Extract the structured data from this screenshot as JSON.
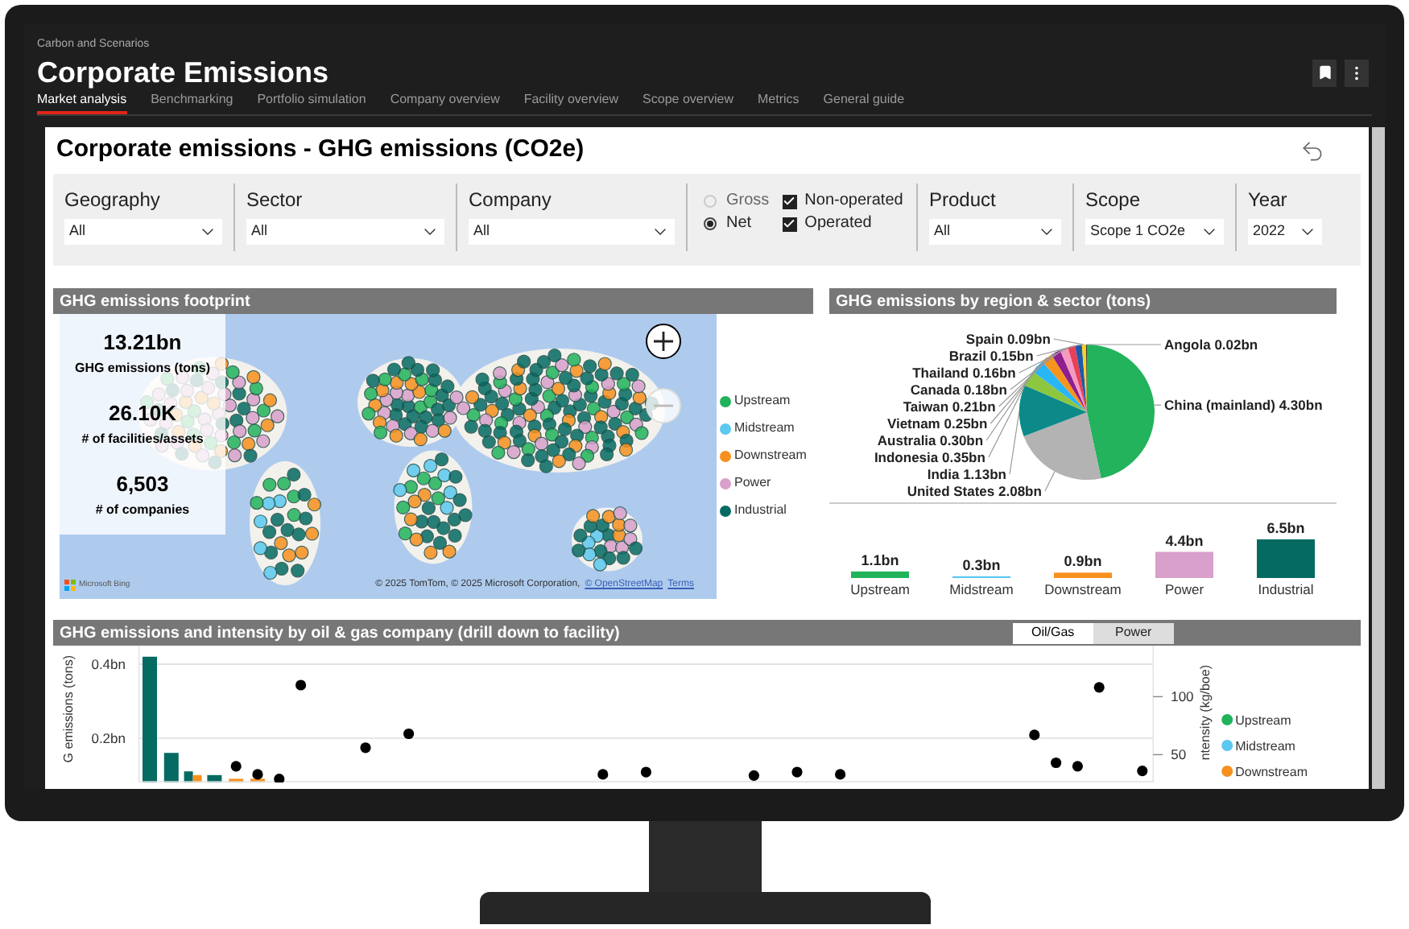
{
  "app": {
    "breadcrumb": "Carbon and Scenarios",
    "title": "Corporate Emissions"
  },
  "tabs": [
    {
      "label": "Market analysis",
      "selected": true
    },
    {
      "label": "Benchmarking",
      "selected": false
    },
    {
      "label": "Portfolio simulation",
      "selected": false
    },
    {
      "label": "Company overview",
      "selected": false
    },
    {
      "label": "Facility overview",
      "selected": false
    },
    {
      "label": "Scope overview",
      "selected": false
    },
    {
      "label": "Metrics",
      "selected": false
    },
    {
      "label": "General guide",
      "selected": false
    }
  ],
  "report": {
    "title": "Corporate emissions - GHG emissions (CO2e)"
  },
  "filters": [
    {
      "kind": "dropdown",
      "label": "Geography",
      "value": "All"
    },
    {
      "kind": "dropdown",
      "label": "Sector",
      "value": "All"
    },
    {
      "kind": "dropdown",
      "label": "Company",
      "value": "All"
    },
    {
      "kind": "options",
      "radios": [
        {
          "label": "Gross",
          "selected": false
        },
        {
          "label": "Net",
          "selected": true
        }
      ],
      "checkboxes": [
        {
          "label": "Non-operated",
          "checked": true
        },
        {
          "label": "Operated",
          "checked": true
        }
      ]
    },
    {
      "kind": "dropdown",
      "label": "Product",
      "value": "All"
    },
    {
      "kind": "dropdown",
      "label": "Scope",
      "value": "Scope 1 CO2e"
    },
    {
      "kind": "dropdown",
      "label": "Year",
      "value": "2022"
    }
  ],
  "footprint": {
    "title": "GHG emissions footprint",
    "kpis": [
      {
        "value": "13.21bn",
        "label": "GHG emissions (tons)"
      },
      {
        "value": "26.10K",
        "label": "# of facilities/assets"
      },
      {
        "value": "6,503",
        "label": "# of companies"
      }
    ],
    "legend": [
      {
        "label": "Upstream",
        "color": "#21b35b"
      },
      {
        "label": "Midstream",
        "color": "#5bc8f0"
      },
      {
        "label": "Downstream",
        "color": "#f7901e"
      },
      {
        "label": "Power",
        "color": "#d9a0cc"
      },
      {
        "label": "Industrial",
        "color": "#046a62"
      }
    ],
    "provider": "Microsoft Bing",
    "attribution": "© 2025 TomTom, © 2025 Microsoft Corporation,",
    "links": [
      "© OpenStreetMap",
      "Terms"
    ]
  },
  "region_sector": {
    "title": "GHG emissions by region & sector (tons)",
    "chart_data": {
      "type": "pie",
      "categories": [
        "China (mainland)",
        "United States",
        "India",
        "Indonesia",
        "Australia",
        "Vietnam",
        "Taiwan",
        "Canada",
        "Thailand",
        "Brazil",
        "Spain",
        "Angola"
      ],
      "values": [
        4.3,
        2.08,
        1.13,
        0.35,
        0.3,
        0.25,
        0.21,
        0.18,
        0.16,
        0.15,
        0.09,
        0.02
      ],
      "value_labels": [
        "4.30bn",
        "2.08bn",
        "1.13bn",
        "0.35bn",
        "0.30bn",
        "0.25bn",
        "0.21bn",
        "0.18bn",
        "0.16bn",
        "0.15bn",
        "0.09bn",
        "0.02bn"
      ],
      "colors": [
        "#22b35c",
        "#b3b3b3",
        "#0c8a8a",
        "#8dc63f",
        "#29b6f6",
        "#f7941d",
        "#8e1f8e",
        "#f49ac1",
        "#e94057",
        "#1e5aa8",
        "#f5d31f",
        "#3a3a3a"
      ]
    },
    "sectors": {
      "chart_data": {
        "type": "bar",
        "categories": [
          "Upstream",
          "Midstream",
          "Downstream",
          "Power",
          "Industrial"
        ],
        "values": [
          1.1,
          0.3,
          0.9,
          4.4,
          6.5
        ],
        "value_labels": [
          "1.1bn",
          "0.3bn",
          "0.9bn",
          "4.4bn",
          "6.5bn"
        ],
        "colors": [
          "#21b35b",
          "#5bc8f0",
          "#f7901e",
          "#d9a0cc",
          "#046a62"
        ]
      }
    }
  },
  "company_chart": {
    "title": "GHG emissions and intensity by oil & gas company (drill down to facility)",
    "toggle": [
      {
        "label": "Oil/Gas",
        "selected": true
      },
      {
        "label": "Power",
        "selected": false
      }
    ],
    "emissions": {
      "chart_data": {
        "type": "bar",
        "ylabel": "G emissions (tons)",
        "categories": [
          null,
          null,
          null,
          null,
          null,
          null,
          null,
          null,
          null,
          null,
          null,
          null,
          null,
          null,
          null,
          null,
          null,
          null,
          null,
          null,
          null,
          null,
          null,
          null,
          null,
          null,
          null,
          null,
          null,
          null,
          null,
          null,
          null,
          null,
          null,
          null,
          null,
          null,
          null,
          null,
          null,
          null,
          null,
          null,
          null,
          null,
          null
        ],
        "series": [
          {
            "color": "#046a62",
            "values": [
              0.42,
              0.16,
              0.11,
              0.1,
              null,
              null,
              null,
              null,
              null,
              null,
              null,
              null,
              null,
              null,
              null,
              null,
              null,
              null,
              null,
              null,
              null,
              null,
              null,
              null,
              null,
              null,
              null,
              null,
              null,
              null,
              null,
              null,
              null,
              null,
              null,
              null,
              null,
              null,
              null,
              null,
              null,
              null,
              null,
              null,
              null,
              null,
              null
            ]
          },
          {
            "color": "#f7901e",
            "values": [
              null,
              null,
              0.1,
              null,
              0.09,
              0.09,
              null,
              null,
              null,
              null,
              null,
              null,
              null,
              null,
              null,
              null,
              null,
              null,
              null,
              null,
              null,
              null,
              null,
              null,
              null,
              null,
              null,
              null,
              null,
              null,
              null,
              null,
              null,
              null,
              null,
              null,
              null,
              null,
              null,
              null,
              null,
              null,
              null,
              null,
              null,
              null,
              null
            ]
          }
        ],
        "ylim": [
          0.08,
          0.45
        ],
        "yticks": [
          {
            "value": 0.2,
            "label": "0.2bn"
          },
          {
            "value": 0.4,
            "label": "0.4bn"
          }
        ]
      }
    },
    "intensity": {
      "chart_data": {
        "type": "scatter",
        "ylabel": "ntensity (kg/boe)",
        "categories": [
          null,
          null,
          null,
          null,
          null,
          null,
          null,
          null,
          null,
          null,
          null,
          null,
          null,
          null,
          null,
          null,
          null,
          null,
          null,
          null,
          null,
          null,
          null,
          null,
          null,
          null,
          null,
          null,
          null,
          null,
          null,
          null,
          null,
          null,
          null,
          null,
          null,
          null,
          null,
          null,
          null,
          null,
          null,
          null,
          null,
          null,
          null
        ],
        "series": [
          {
            "color": "#000000",
            "values": [
              null,
              null,
              null,
              null,
              40,
              33,
              29,
              110,
              null,
              null,
              56,
              null,
              68,
              null,
              null,
              null,
              null,
              null,
              null,
              null,
              null,
              33,
              null,
              35,
              null,
              null,
              null,
              null,
              32,
              null,
              35,
              null,
              33,
              null,
              null,
              null,
              null,
              null,
              null,
              null,
              null,
              67,
              43,
              40,
              108,
              null,
              36
            ]
          }
        ],
        "ylim": [
          26,
          144
        ],
        "yticks": [
          {
            "value": 50,
            "label": "50"
          },
          {
            "value": 100,
            "label": "100"
          }
        ]
      }
    },
    "legend": [
      {
        "label": "Upstream",
        "color": "#21b35b"
      },
      {
        "label": "Midstream",
        "color": "#5bc8f0"
      },
      {
        "label": "Downstream",
        "color": "#f7901e"
      }
    ]
  }
}
